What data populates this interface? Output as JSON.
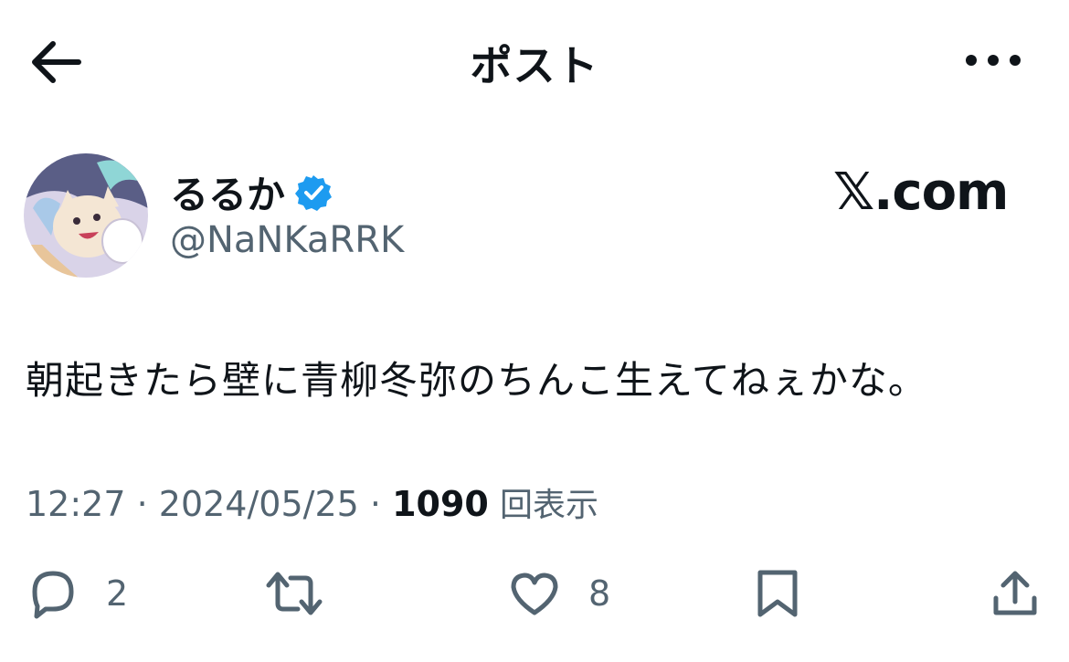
{
  "header": {
    "title": "ポスト",
    "back_icon": "arrow-left-icon",
    "more_icon": "more-horizontal-icon"
  },
  "author": {
    "display_name": "るるか",
    "handle": "@NaNKaRRK",
    "verified": true,
    "verified_color": "#1d9bf0"
  },
  "brand": "𝕏.com",
  "post": {
    "text": "朝起きたら壁に青柳冬弥のちんこ生えてねぇかな。",
    "time": "12:27",
    "date": "2024/05/25",
    "views_count": "1090",
    "views_label": "回表示"
  },
  "actions": {
    "reply_count": "2",
    "retweet_count": "",
    "like_count": "8"
  },
  "colors": {
    "text": "#0f1419",
    "secondary": "#536471",
    "accent": "#1d9bf0"
  }
}
